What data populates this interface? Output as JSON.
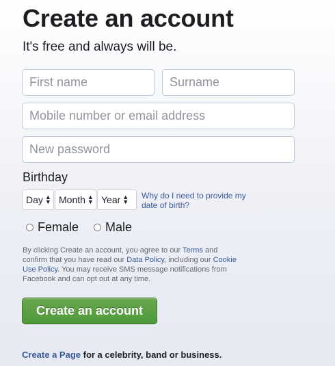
{
  "header": {
    "title": "Create an account",
    "subtitle": "It's free and always will be."
  },
  "form": {
    "first_name_placeholder": "First name",
    "surname_placeholder": "Surname",
    "contact_placeholder": "Mobile number or email address",
    "password_placeholder": "New password"
  },
  "birthday": {
    "label": "Birthday",
    "day": "Day",
    "month": "Month",
    "year": "Year",
    "why_link": "Why do I need to provide my date of birth?"
  },
  "gender": {
    "female": "Female",
    "male": "Male"
  },
  "terms": {
    "part1": "By clicking Create an account, you agree to our ",
    "terms_link": "Terms",
    "part2": " and confirm that you have read our ",
    "data_policy_link": "Data Policy",
    "part3": ", including our ",
    "cookie_link": "Cookie Use Policy",
    "part4": ". You may receive SMS message notifications from Facebook and can opt out at any time."
  },
  "submit_label": "Create an account",
  "footer": {
    "link": "Create a Page",
    "text": " for a celebrity, band or business."
  },
  "colors": {
    "link": "#385898",
    "button": "#4e9a3a",
    "text": "#1c1e21"
  }
}
